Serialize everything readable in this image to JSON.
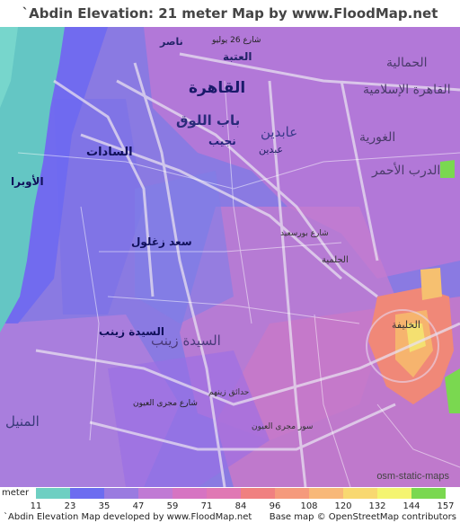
{
  "title": "`Abdin Elevation: 21 meter Map by www.FloodMap.net (beta)",
  "map": {
    "attribution": "osm-static-maps",
    "labels": [
      {
        "text": "القاهرة",
        "key": "cairo"
      },
      {
        "text": "باب اللوق",
        "key": "bab-el-louk"
      },
      {
        "text": "السادات",
        "key": "sadat"
      },
      {
        "text": "نجيب",
        "key": "nagib"
      },
      {
        "text": "عابدين",
        "key": "abdin"
      },
      {
        "text": "سعد زغلول",
        "key": "saad-zaghloul"
      },
      {
        "text": "السيدة زينب",
        "key": "sayeda-zeinab"
      },
      {
        "text": "السيدة زينب",
        "key": "sayeda-zeinab-2"
      },
      {
        "text": "المنيل",
        "key": "manial"
      },
      {
        "text": "الأوبرا",
        "key": "opera"
      },
      {
        "text": "الحمالية",
        "key": "gamaleya"
      },
      {
        "text": "القاهرة الإسلامية",
        "key": "islamic-cairo"
      },
      {
        "text": "الغورية",
        "key": "ghouria"
      },
      {
        "text": "الدرب الأحمر",
        "key": "darb-ahmar"
      },
      {
        "text": "الخليفة",
        "key": "khalifa"
      },
      {
        "text": "الحلمية",
        "key": "helmeya"
      },
      {
        "text": "العتبة",
        "key": "ataba"
      },
      {
        "text": "ناصر",
        "key": "nasser"
      },
      {
        "text": "عبدين",
        "key": "abdin-2"
      },
      {
        "text": "شارع 26 يوليو",
        "key": "26-july"
      },
      {
        "text": "حدائق زينهم",
        "key": "zeinhom"
      },
      {
        "text": "شارع مجرى العيون",
        "key": "magra"
      },
      {
        "text": "سور مجرى العيون",
        "key": "sour"
      },
      {
        "text": "شارع بورسعيد",
        "key": "port-said"
      }
    ]
  },
  "legend": {
    "unit": "meter",
    "ticks": [
      "11",
      "23",
      "35",
      "47",
      "59",
      "71",
      "84",
      "96",
      "108",
      "120",
      "132",
      "144",
      "157"
    ],
    "colors": [
      "#6ecfc2",
      "#6c6cf0",
      "#9a7be0",
      "#c07ad4",
      "#d674c2",
      "#e078b4",
      "#f08080",
      "#f59a7c",
      "#f8b878",
      "#f8d870",
      "#f4f470",
      "#7ad850",
      "#40c040"
    ]
  },
  "footer": {
    "left": "`Abdin Elevation Map developed by www.FloodMap.net",
    "right": "Base map © OpenStreetMap contributors"
  }
}
